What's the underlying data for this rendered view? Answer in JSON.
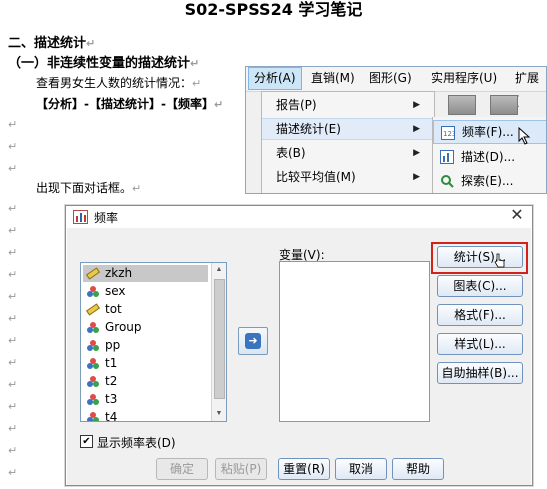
{
  "document": {
    "title": "S02-SPSS24 学习笔记",
    "section2": "二、描述统计",
    "subsection1": "（一）非连续性变量的描述统计",
    "line_check": "查看男女生人数的统计情况：",
    "line_path": "【分析】-【描述统计】-【频率】",
    "line_dialog": "出现下面对话框。",
    "para_mark": "↵"
  },
  "menu": {
    "menubar": [
      "分析(A)",
      "直销(M)",
      "图形(G)",
      "实用程序(U)",
      "扩展("
    ],
    "dropdown": [
      "报告(P)",
      "描述统计(E)",
      "表(B)",
      "比较平均值(M)"
    ],
    "submenu": [
      "频率(F)...",
      "描述(D)...",
      "探索(E)..."
    ]
  },
  "dialog": {
    "title": "频率",
    "close_glyph": "✕",
    "variable_label": "变量(V):",
    "variables": [
      {
        "name": "zkzh",
        "icon": "ruler-icon",
        "selected": true
      },
      {
        "name": "sex",
        "icon": "nominal-icon"
      },
      {
        "name": "tot",
        "icon": "ruler-icon"
      },
      {
        "name": "Group",
        "icon": "nominal-icon"
      },
      {
        "name": "pp",
        "icon": "nominal-icon"
      },
      {
        "name": "t1",
        "icon": "nominal-icon"
      },
      {
        "name": "t2",
        "icon": "nominal-icon"
      },
      {
        "name": "t3",
        "icon": "nominal-icon"
      },
      {
        "name": "t4",
        "icon": "nominal-icon"
      }
    ],
    "side_buttons": [
      "统计(S)...",
      "图表(C)...",
      "格式(F)...",
      "样式(L)...",
      "自助抽样(B)..."
    ],
    "checkbox_label": "显示频率表(D)",
    "checkbox_checked": true,
    "bottom_buttons": [
      "确定",
      "粘贴(P)",
      "重置(R)",
      "取消",
      "帮助"
    ],
    "highlight_color": "#d0231c"
  }
}
